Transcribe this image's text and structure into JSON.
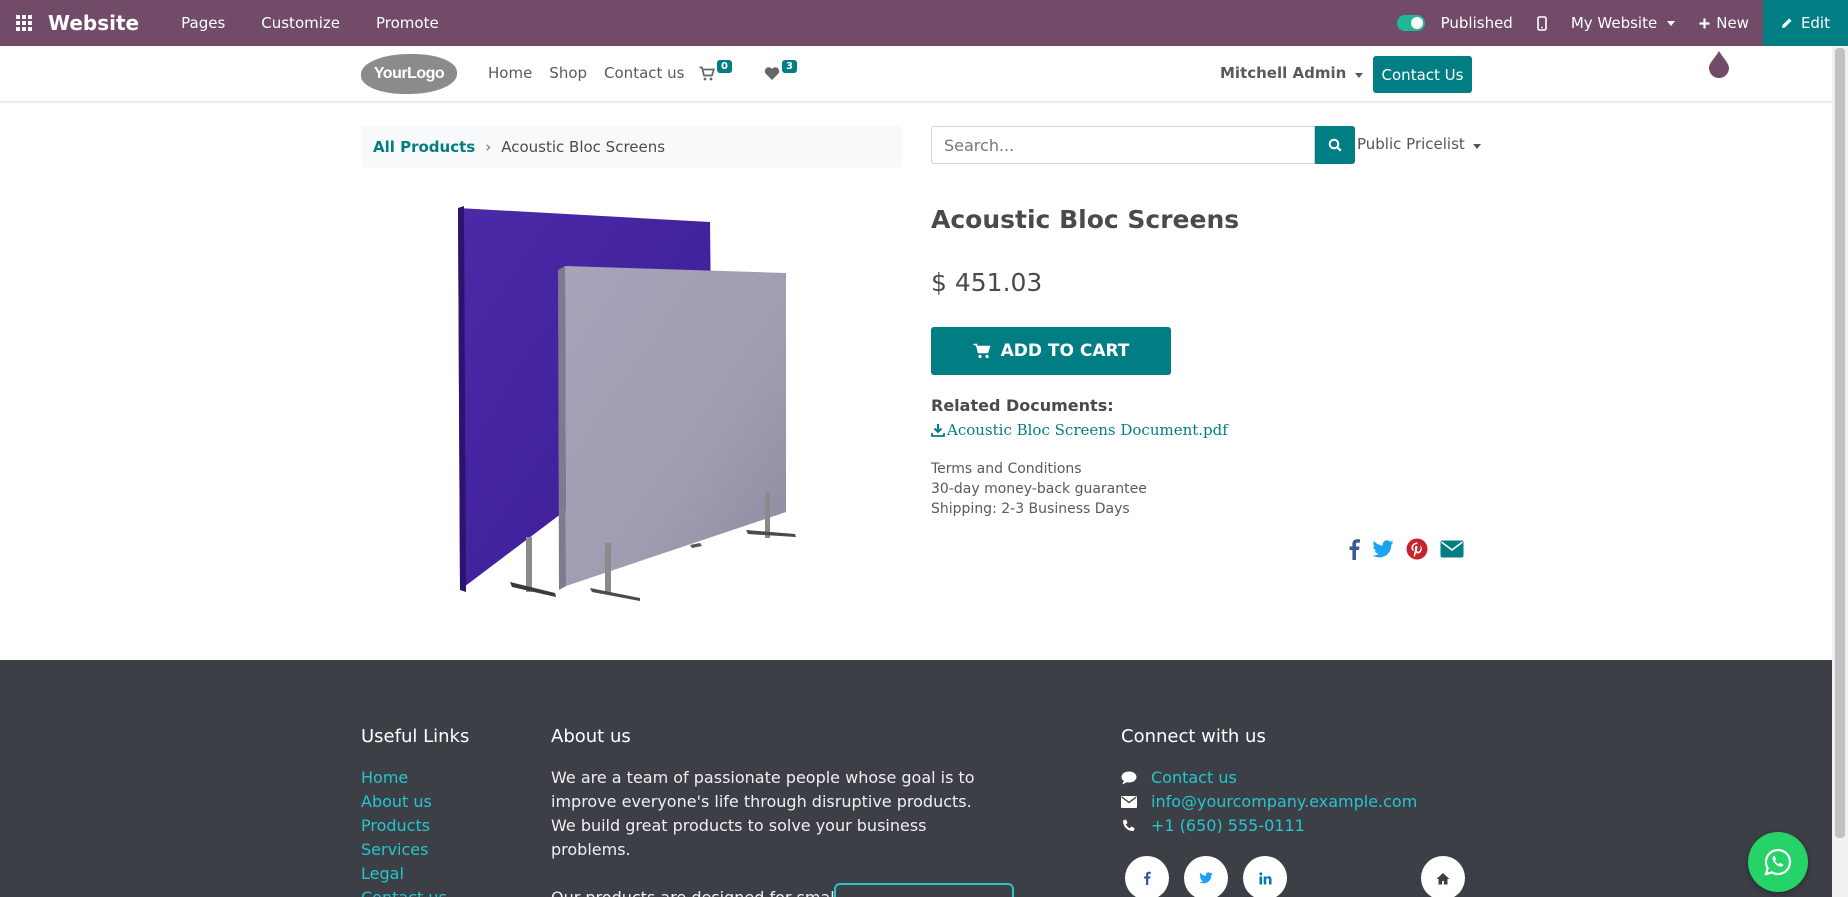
{
  "topbar": {
    "brand": "Website",
    "menu": [
      "Pages",
      "Customize",
      "Promote"
    ],
    "published_label": "Published",
    "website_label": "My Website",
    "new_label": "New",
    "edit_label": "Edit",
    "color": "#714b67"
  },
  "header": {
    "logo_text": "YourLogo",
    "nav": [
      "Home",
      "Shop",
      "Contact us"
    ],
    "cart_count": "0",
    "wishlist_count": "3",
    "user": "Mitchell Admin",
    "contact_button": "Contact Us"
  },
  "breadcrumb": {
    "parent": "All Products",
    "current": "Acoustic Bloc Screens"
  },
  "search": {
    "placeholder": "Search...",
    "pricelist": "Public Pricelist"
  },
  "product": {
    "name": "Acoustic Bloc Screens",
    "price": "$ 451.03",
    "add_to_cart": "ADD TO CART",
    "related_docs_label": "Related Documents:",
    "document": "Acoustic Bloc Screens Document.pdf",
    "terms": [
      "Terms and Conditions",
      "30-day money-back guarantee",
      "Shipping: 2-3 Business Days"
    ],
    "share_icons": [
      "facebook-icon",
      "twitter-icon",
      "pinterest-icon",
      "envelope-icon"
    ]
  },
  "footer": {
    "useful_links_title": "Useful Links",
    "useful_links": [
      "Home",
      "About us",
      "Products",
      "Services",
      "Legal",
      "Contact us"
    ],
    "about_title": "About us",
    "about_p1": "We are a team of passionate people whose goal is to improve everyone's life through disruptive products. We build great products to solve your business problems.",
    "about_p2": "Our products are designed for small to medium size companies willing to optimize their performance.",
    "connect_title": "Connect with us",
    "contact_link": "Contact us",
    "email": "info@yourcompany.example.com",
    "phone": "+1 (650) 555-0111"
  },
  "colors": {
    "accent": "#017e84",
    "footer_bg": "#3c3f46",
    "footer_link": "#27c5cc"
  }
}
